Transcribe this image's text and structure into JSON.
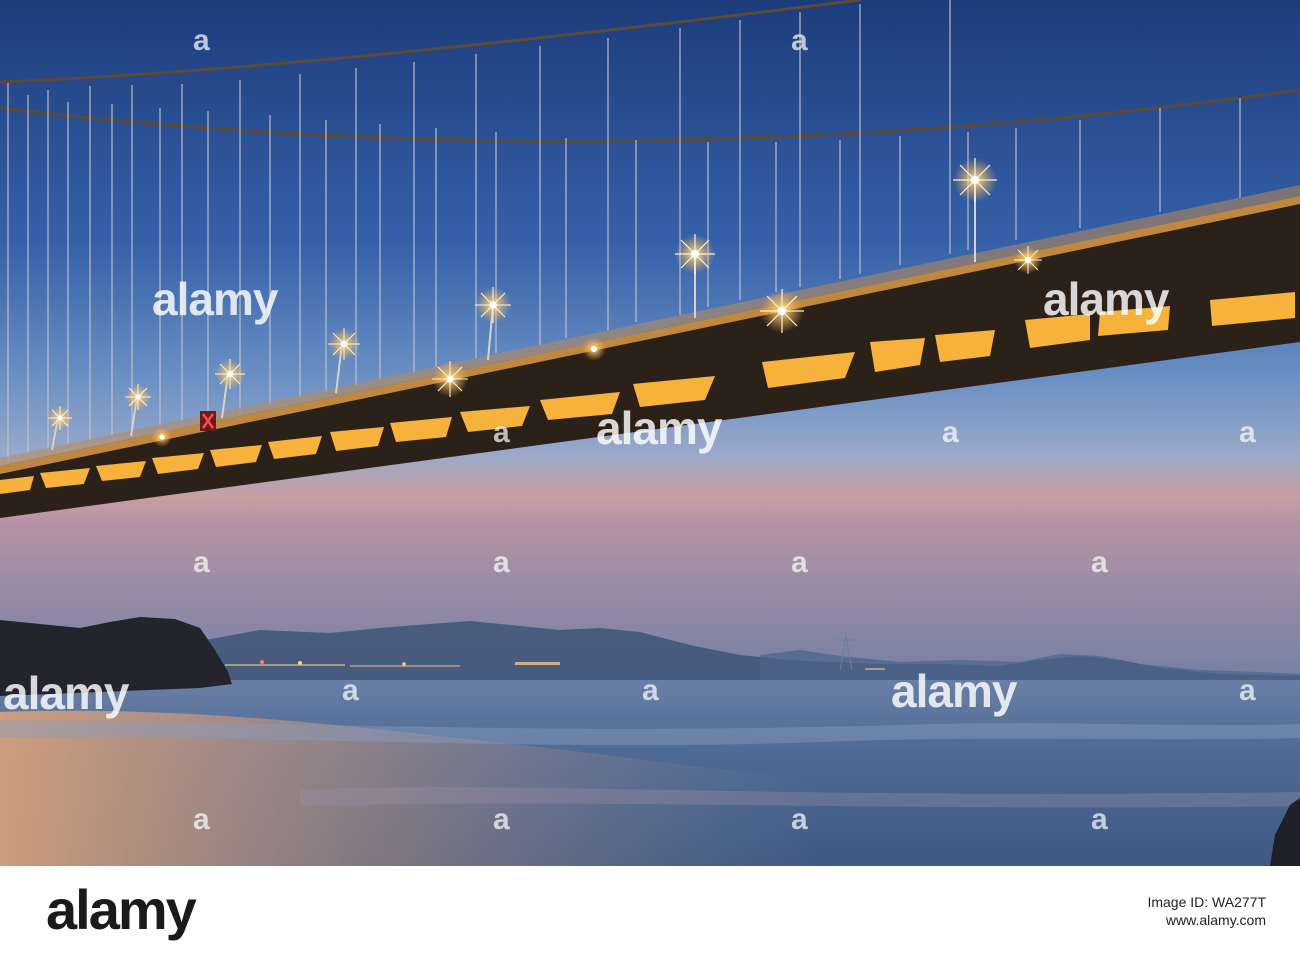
{
  "watermark": {
    "logo_text": "alamy",
    "letter": "a"
  },
  "footer": {
    "logo_text": "alamy",
    "image_id": "Image ID: WA277T",
    "site": "www.alamy.com"
  },
  "colors": {
    "sky_top": "#1f3d7e",
    "sky_mid": "#4f78b4",
    "horizon_pink": "#c79fa2",
    "deck_dark": "#2a2018",
    "deck_light": "#f5a623",
    "water": "#4d6a8c"
  }
}
